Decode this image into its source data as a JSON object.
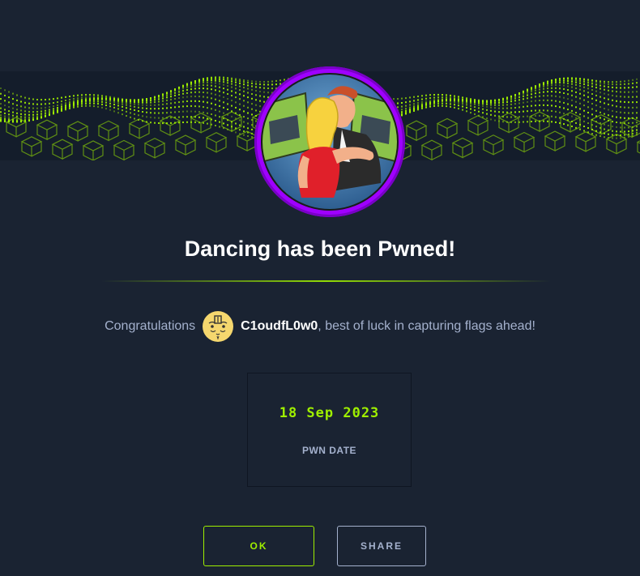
{
  "machine": {
    "title": "Dancing has been Pwned!"
  },
  "congrats": {
    "prefix": "Congratulations",
    "username": "C1oudfL0w0",
    "suffix": ", best of luck in capturing flags ahead!"
  },
  "pwn_card": {
    "date": "18 Sep 2023",
    "label": "PWN DATE"
  },
  "buttons": {
    "ok_label": "OK",
    "share_label": "SHARE"
  },
  "colors": {
    "background": "#1a2332",
    "accent": "#9fef00",
    "avatar_ring": "#9f00ff",
    "muted_text": "#a4b1cd"
  },
  "icons": {
    "banner": "green-cube-wave-banner",
    "machine_avatar": "dancing-couple-avatar",
    "user_avatar": "cartoon-face-avatar"
  }
}
